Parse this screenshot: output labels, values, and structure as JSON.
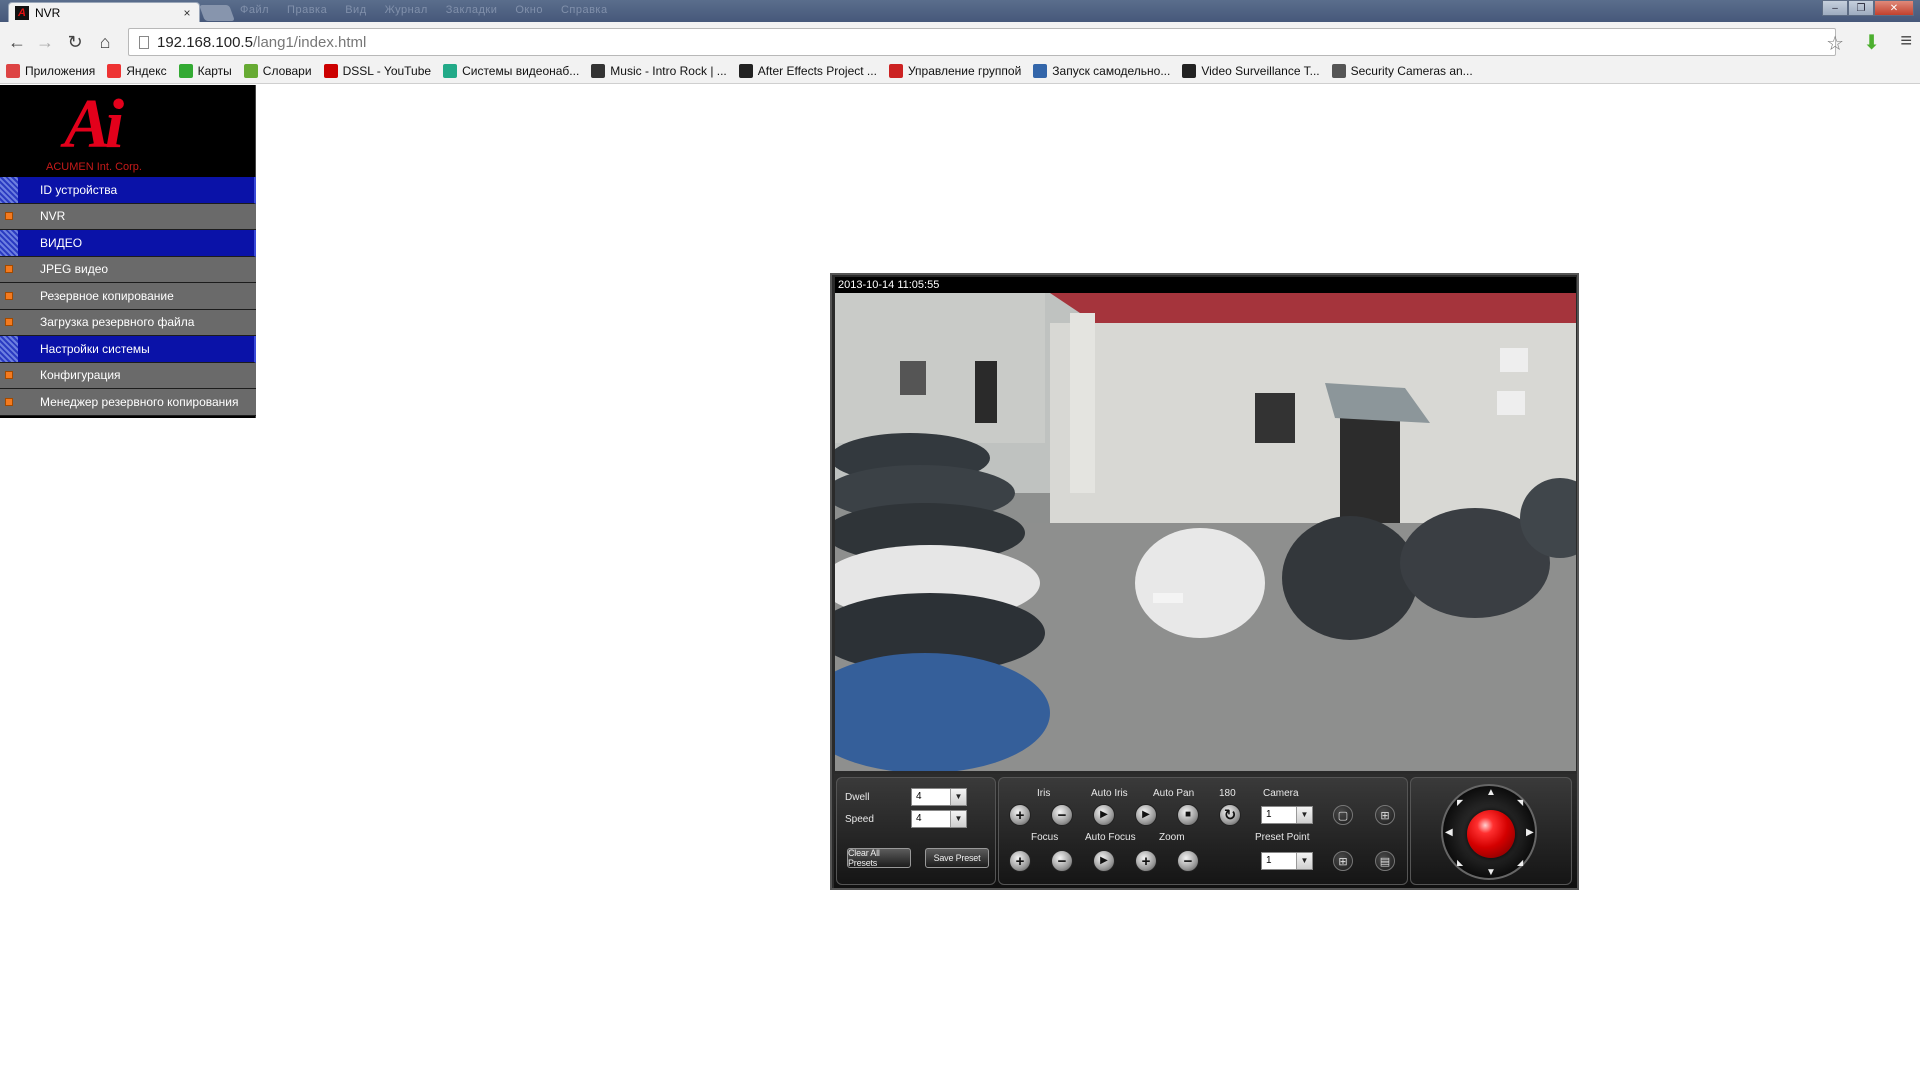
{
  "browser": {
    "tab_title": "NVR",
    "tab_close": "×",
    "url_host": "192.168.100.5",
    "url_path": "/lang1/index.html",
    "blurred_menu": [
      "Файл",
      "Правка",
      "Вид",
      "Журнал",
      "Закладки",
      "Окно",
      "Справка"
    ],
    "bookmarks": [
      {
        "label": "Приложения",
        "color": "#d44"
      },
      {
        "label": "Яндекс",
        "color": "#e33"
      },
      {
        "label": "Карты",
        "color": "#3a3"
      },
      {
        "label": "Словари",
        "color": "#6a3"
      },
      {
        "label": "DSSL - YouTube",
        "color": "#c00"
      },
      {
        "label": "Системы видеонаб...",
        "color": "#2a8"
      },
      {
        "label": "Music - Intro Rock | ...",
        "color": "#333"
      },
      {
        "label": "After Effects Project ...",
        "color": "#222"
      },
      {
        "label": "Управление группой",
        "color": "#c22"
      },
      {
        "label": "Запуск самодельно...",
        "color": "#36a"
      },
      {
        "label": "Video Surveillance T...",
        "color": "#222"
      },
      {
        "label": "Security Cameras an...",
        "color": "#555"
      }
    ]
  },
  "sidebar": {
    "logo_mark": "Ai",
    "logo_brand": "ACUMEN Int. Corp.",
    "items": [
      {
        "label": "ID устройства",
        "kind": "header"
      },
      {
        "label": "NVR",
        "kind": "item"
      },
      {
        "label": "ВИДЕО",
        "kind": "header"
      },
      {
        "label": "JPEG видео",
        "kind": "item"
      },
      {
        "label": "Резервное копирование",
        "kind": "item"
      },
      {
        "label": "Загрузка резервного файла",
        "kind": "item"
      },
      {
        "label": "Настройки системы",
        "kind": "header"
      },
      {
        "label": "Конфигурация",
        "kind": "item"
      },
      {
        "label": "Менеджер резервного копирования",
        "kind": "item"
      }
    ]
  },
  "viewer": {
    "timestamp": "2013-10-14 11:05:55",
    "ptz": {
      "dwell_label": "Dwell",
      "dwell_value": "4",
      "speed_label": "Speed",
      "speed_value": "4",
      "clear_presets": "Clear All Presets",
      "save_preset": "Save Preset",
      "iris_label": "Iris",
      "auto_iris_label": "Auto Iris",
      "auto_pan_label": "Auto Pan",
      "rotate_label": "180",
      "camera_label": "Camera",
      "camera_value": "1",
      "focus_label": "Focus",
      "auto_focus_label": "Auto Focus",
      "zoom_label": "Zoom",
      "preset_point_label": "Preset Point",
      "preset_point_value": "1"
    }
  },
  "colors": {
    "menu_header": "#0a12a8",
    "menu_item": "#6a6a6a",
    "bullet": "#f47a1f",
    "logo": "#e3001b"
  }
}
